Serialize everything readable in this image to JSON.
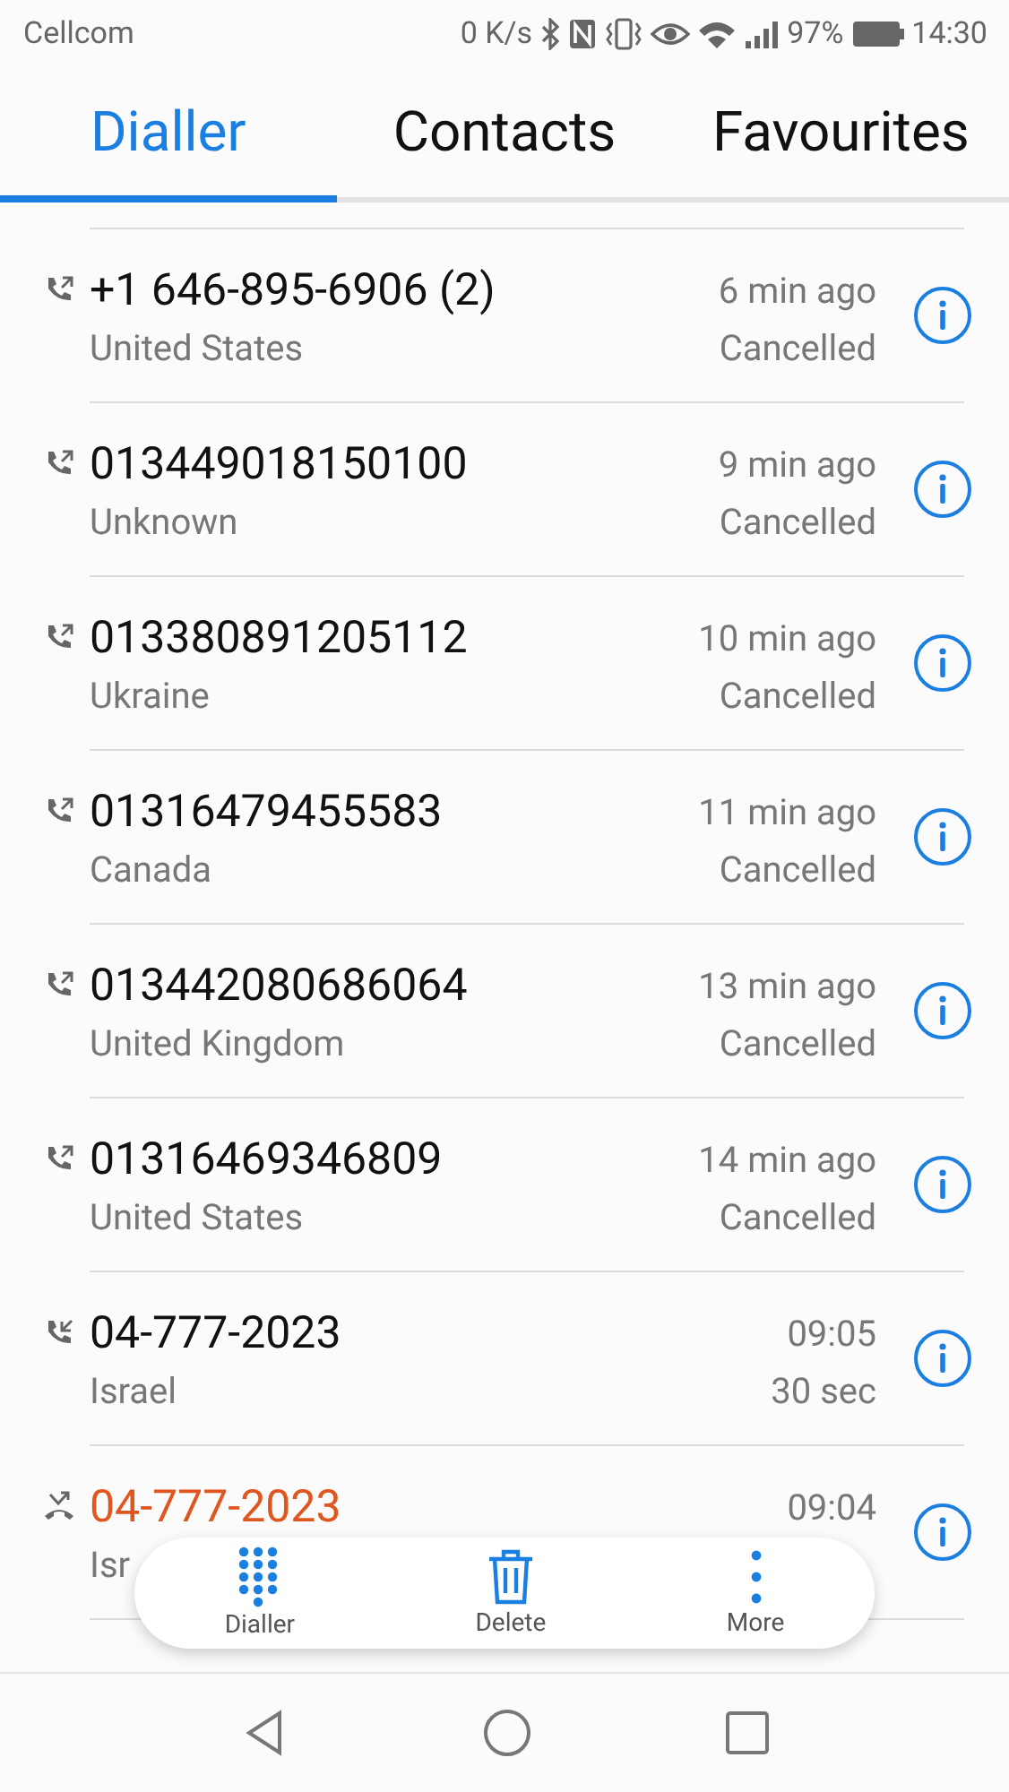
{
  "status_bar": {
    "carrier": "Cellcom",
    "speed": "0 K/s",
    "battery": "97%",
    "time": "14:30"
  },
  "tabs": [
    {
      "label": "Dialler",
      "selected": true
    },
    {
      "label": "Contacts",
      "selected": false
    },
    {
      "label": "Favourites",
      "selected": false
    }
  ],
  "calls": [
    {
      "kind": "outgoing",
      "number": "+1 646-895-6906 (2)",
      "location": "United States",
      "time": "6 min ago",
      "status": "Cancelled"
    },
    {
      "kind": "outgoing",
      "number": "013449018150100",
      "location": "Unknown",
      "time": "9 min ago",
      "status": "Cancelled"
    },
    {
      "kind": "outgoing",
      "number": "013380891205112",
      "location": "Ukraine",
      "time": "10 min ago",
      "status": "Cancelled"
    },
    {
      "kind": "outgoing",
      "number": "01316479455583",
      "location": "Canada",
      "time": "11 min ago",
      "status": "Cancelled"
    },
    {
      "kind": "outgoing",
      "number": "013442080686064",
      "location": "United Kingdom",
      "time": "13 min ago",
      "status": "Cancelled"
    },
    {
      "kind": "outgoing",
      "number": "01316469346809",
      "location": "United States",
      "time": "14 min ago",
      "status": "Cancelled"
    },
    {
      "kind": "incoming",
      "number": "04-777-2023",
      "location": "Israel",
      "time": "09:05",
      "status": "30 sec"
    },
    {
      "kind": "missed",
      "number": "04-777-2023",
      "location": "Isr",
      "time": "09:04"
    }
  ],
  "toolbar": [
    {
      "kind": "dialpad",
      "label": "Dialler"
    },
    {
      "kind": "delete",
      "label": "Delete"
    },
    {
      "kind": "more",
      "label": "More"
    }
  ]
}
